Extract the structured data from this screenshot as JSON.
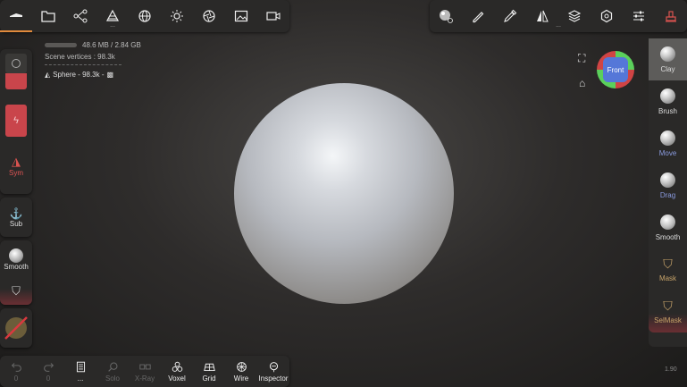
{
  "top_left_icons": [
    "menu-icon",
    "folder-icon",
    "scene-graph-icon",
    "stack-icon",
    "globe-icon",
    "sun-icon",
    "aperture-icon",
    "image-icon",
    "video-camera-icon"
  ],
  "top_right_icons": [
    "material-icon",
    "pen-icon",
    "eyedropper-icon",
    "symmetry-icon",
    "layers-icon",
    "gear-icon",
    "sliders-icon",
    "stamp-icon"
  ],
  "info": {
    "memory": "48.6 MB / 2.84 GB",
    "scene_vertices": "Scene vertices : 98.3k",
    "object": "Sphere - 98.3k -"
  },
  "left_panel": {
    "sym_label": "Sym",
    "sub_label": "Sub",
    "smooth_label": "Smooth"
  },
  "right_tools": [
    {
      "label": "Clay",
      "active": true
    },
    {
      "label": "Brush",
      "active": false
    },
    {
      "label": "Move",
      "active": false
    },
    {
      "label": "Drag",
      "active": false
    },
    {
      "label": "Smooth",
      "active": false
    },
    {
      "label": "Mask",
      "active": false
    },
    {
      "label": "SelMask",
      "active": false
    }
  ],
  "gizmo": {
    "face_label": "Front"
  },
  "bottom_bar": [
    {
      "label": "0",
      "icon": "undo-icon",
      "enabled": false
    },
    {
      "label": "0",
      "icon": "redo-icon",
      "enabled": false
    },
    {
      "label": "...",
      "icon": "file-icon",
      "enabled": true
    },
    {
      "label": "Solo",
      "icon": "search-icon",
      "enabled": false
    },
    {
      "label": "X-Ray",
      "icon": "glasses-icon",
      "enabled": false
    },
    {
      "label": "Voxel",
      "icon": "voxel-icon",
      "enabled": true
    },
    {
      "label": "Grid",
      "icon": "grid-icon",
      "enabled": true
    },
    {
      "label": "Wire",
      "icon": "wire-icon",
      "enabled": true
    },
    {
      "label": "Inspector",
      "icon": "inspector-icon",
      "enabled": true
    }
  ],
  "version": "1.90",
  "colors": {
    "accent": "#e08a3c",
    "red": "#c9454b",
    "panel": "#2a2928"
  }
}
